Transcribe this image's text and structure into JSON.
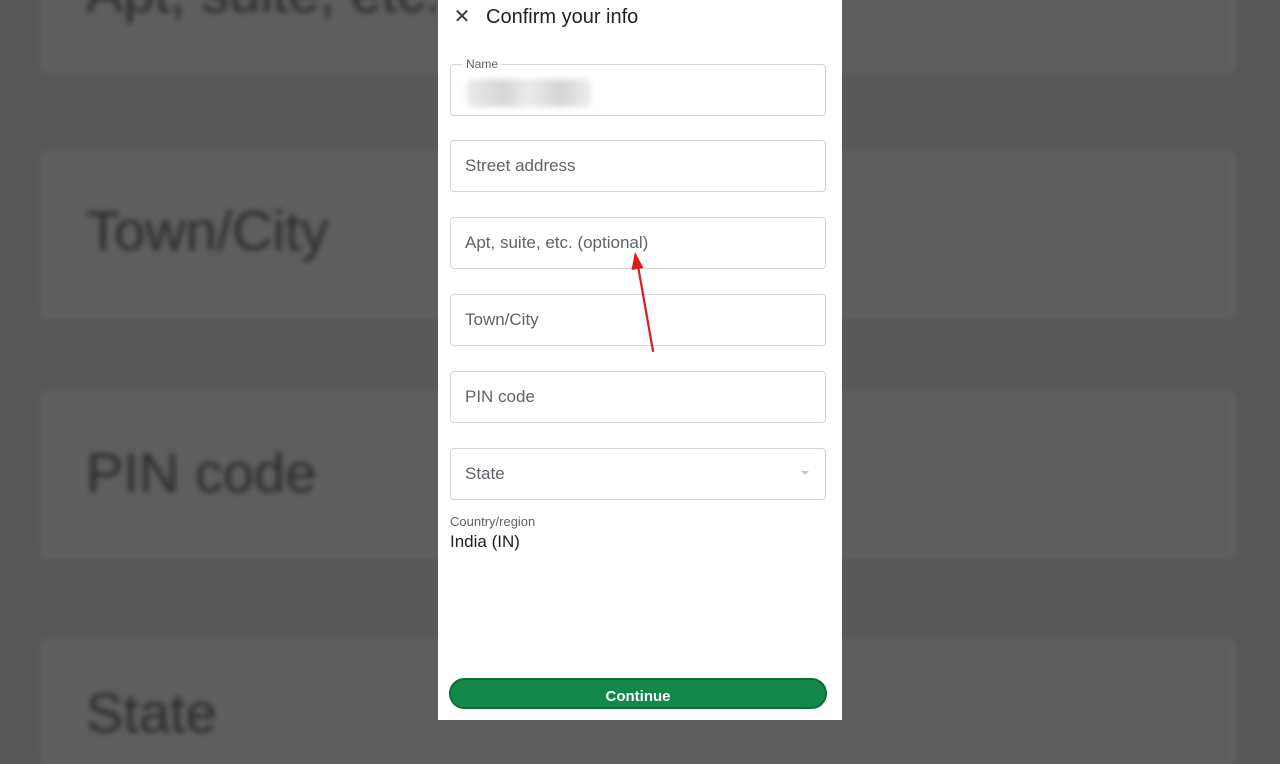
{
  "background": {
    "labels": [
      "Apt, suite, etc.",
      "Town/City",
      "PIN code",
      "State"
    ]
  },
  "dialog": {
    "title": "Confirm your info",
    "close_icon": "close-icon"
  },
  "form": {
    "name": {
      "label": "Name",
      "value": ""
    },
    "street": {
      "placeholder": "Street address"
    },
    "apt": {
      "placeholder": "Apt, suite, etc. (optional)"
    },
    "city": {
      "placeholder": "Town/City"
    },
    "pin": {
      "placeholder": "PIN code"
    },
    "state": {
      "placeholder": "State",
      "icon": "chevron-down-icon"
    },
    "country": {
      "label": "Country/region",
      "value": "India (IN)"
    }
  },
  "actions": {
    "continue_label": "Continue"
  },
  "colors": {
    "accent": "#12894a",
    "annotation": "#d71f1f"
  }
}
